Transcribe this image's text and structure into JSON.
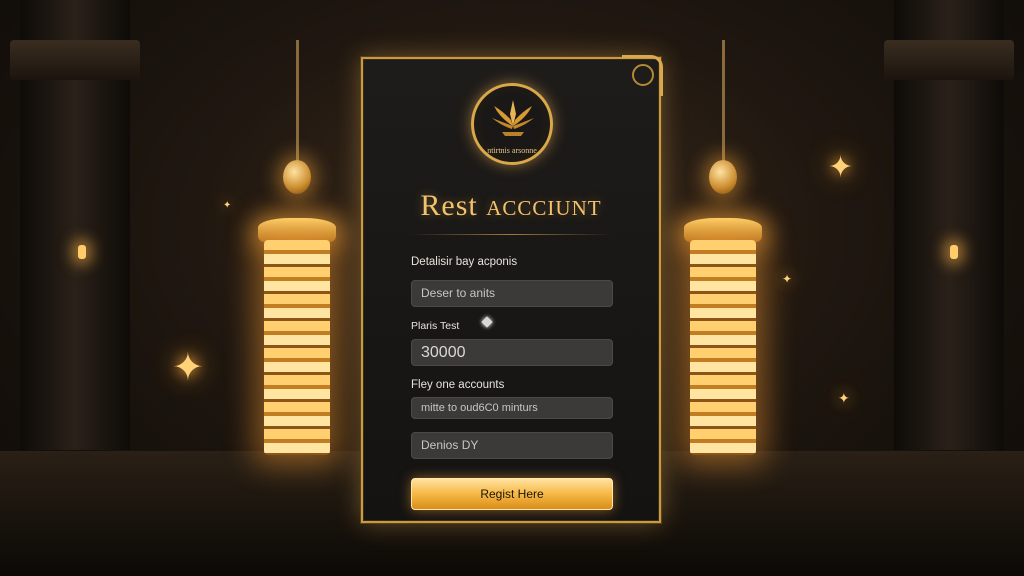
{
  "background": {
    "accent_color": "#f2c36a",
    "left_tower_icon": "golden-tower",
    "right_tower_icon": "golden-tower"
  },
  "form": {
    "emblem_icon": "golden-crest-icon",
    "emblem_text": "ntirtnis arsonne",
    "title_main": "Rest",
    "title_sub": "ACCCIUNT",
    "section1_label": "Detalisir bay acponis",
    "field1_value": "Deser to anits",
    "section2_label": "Plaris Test",
    "field2_value": "30000",
    "section3_label": "Fley one accounts",
    "field3_value": "mitte to oud6C0 minturs",
    "field4_value": "Denios DY",
    "submit_label": "Regist Here"
  }
}
